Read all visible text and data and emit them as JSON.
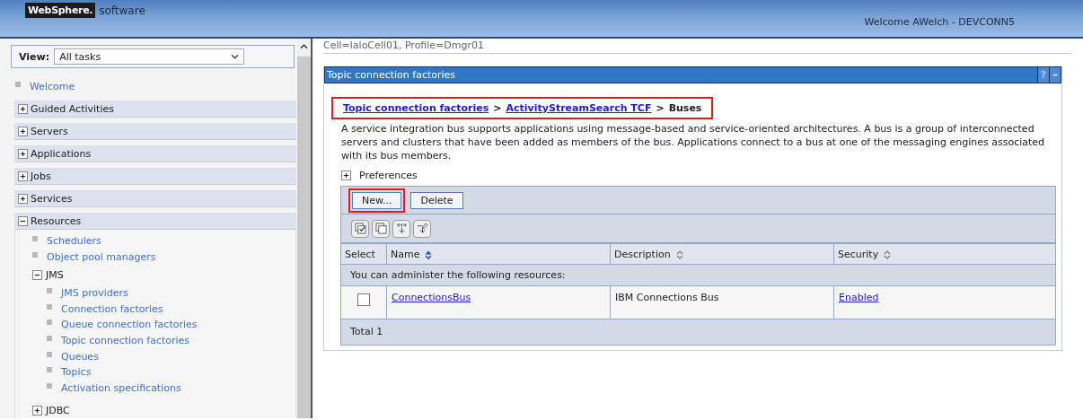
{
  "header": {
    "logo_mark": "WebSphere.",
    "logo_text": "software",
    "welcome": "Welcome AWelch - DEVCONN5"
  },
  "sidebar": {
    "view_label": "View:",
    "view_value": "All tasks",
    "items": [
      {
        "kind": "link",
        "label": "Welcome"
      },
      {
        "kind": "section",
        "label": "Guided Activities",
        "expanded": false
      },
      {
        "kind": "section",
        "label": "Servers",
        "expanded": false
      },
      {
        "kind": "section",
        "label": "Applications",
        "expanded": false
      },
      {
        "kind": "section",
        "label": "Jobs",
        "expanded": false
      },
      {
        "kind": "section",
        "label": "Services",
        "expanded": false
      },
      {
        "kind": "section",
        "label": "Resources",
        "expanded": true,
        "children": [
          {
            "kind": "link",
            "label": "Schedulers"
          },
          {
            "kind": "link",
            "label": "Object pool managers"
          },
          {
            "kind": "folder",
            "label": "JMS",
            "expanded": true,
            "children": [
              {
                "kind": "link",
                "label": "JMS providers"
              },
              {
                "kind": "link",
                "label": "Connection factories"
              },
              {
                "kind": "link",
                "label": "Queue connection factories"
              },
              {
                "kind": "link",
                "label": "Topic connection factories"
              },
              {
                "kind": "link",
                "label": "Queues"
              },
              {
                "kind": "link",
                "label": "Topics"
              },
              {
                "kind": "link",
                "label": "Activation specifications"
              }
            ]
          },
          {
            "kind": "folder",
            "label": "JDBC",
            "expanded": false
          }
        ]
      }
    ]
  },
  "content": {
    "scope": "Cell=laloCell01, Profile=Dmgr01",
    "panel": {
      "title": "Topic connection factories",
      "help": "?",
      "minimize": "–",
      "breadcrumb": {
        "highlighted": true,
        "links": [
          "Topic connection factories",
          "ActivityStreamSearch TCF"
        ],
        "separator": ">",
        "current": "Buses"
      },
      "description": "A service integration bus supports applications using message-based and service-oriented architectures. A bus is a group of interconnected servers and clusters that have been added as members of the bus. Applications connect to a bus at one of the messaging engines associated with its bus members.",
      "preferences": {
        "label": "Preferences",
        "expanded": false
      },
      "buttons": [
        {
          "label": "New...",
          "highlighted": true
        },
        {
          "label": "Delete",
          "highlighted": false
        }
      ],
      "table": {
        "columns": [
          {
            "label": "Select"
          },
          {
            "label": "Name",
            "sorted": true
          },
          {
            "label": "Description",
            "sorted": false
          },
          {
            "label": "Security",
            "sorted": false
          }
        ],
        "group_label": "You can administer the following resources:",
        "rows": [
          {
            "checked": false,
            "name": "ConnectionsBus",
            "description": "IBM Connections Bus",
            "security": "Enabled"
          }
        ],
        "total": "Total 1"
      }
    }
  }
}
